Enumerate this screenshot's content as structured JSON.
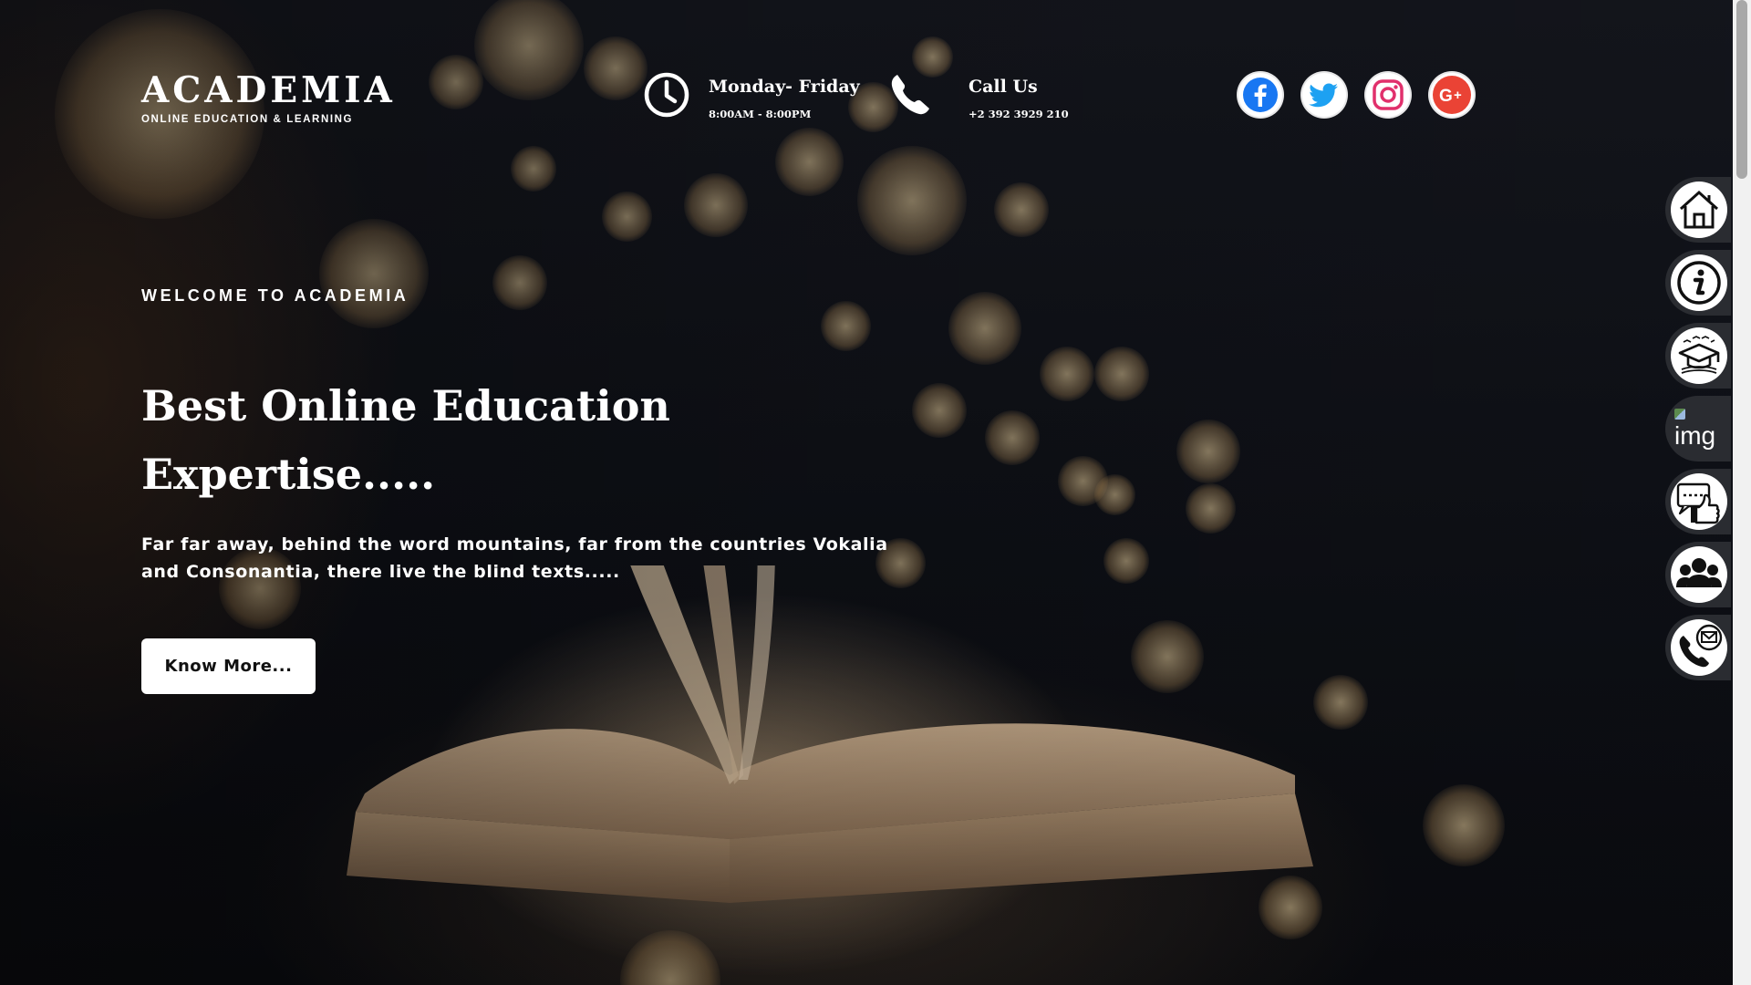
{
  "brand": {
    "title": "ACADEMIA",
    "subtitle": "Online Education & Learning"
  },
  "header": {
    "hours": {
      "title": "Monday- Friday",
      "detail": "8:00AM - 8:00PM",
      "icon": "clock-icon"
    },
    "phone": {
      "title": "Call Us",
      "detail": "+2 392 3929 210",
      "icon": "phone-icon"
    },
    "social": [
      {
        "name": "facebook-icon",
        "color": "#1877f2"
      },
      {
        "name": "twitter-icon",
        "color": "#1da1f2"
      },
      {
        "name": "instagram-icon",
        "color": "#e1306c"
      },
      {
        "name": "google-plus-icon",
        "color": "#ea4335"
      }
    ]
  },
  "hero": {
    "eyebrow": "Welcome to Academia",
    "headline": "Best Online Education Expertise.....",
    "lead": "Far far away, behind the word mountains, far from the countries Vokalia and Consonantia, there live the blind texts.....",
    "button_label": "Know More..."
  },
  "sidenav": [
    {
      "name": "home-icon"
    },
    {
      "name": "info-icon"
    },
    {
      "name": "graduation-cap-icon"
    },
    {
      "name": "broken-image",
      "alt": "img"
    },
    {
      "name": "feedback-thumbs-up-icon"
    },
    {
      "name": "team-icon"
    },
    {
      "name": "contact-phone-mail-icon"
    }
  ]
}
